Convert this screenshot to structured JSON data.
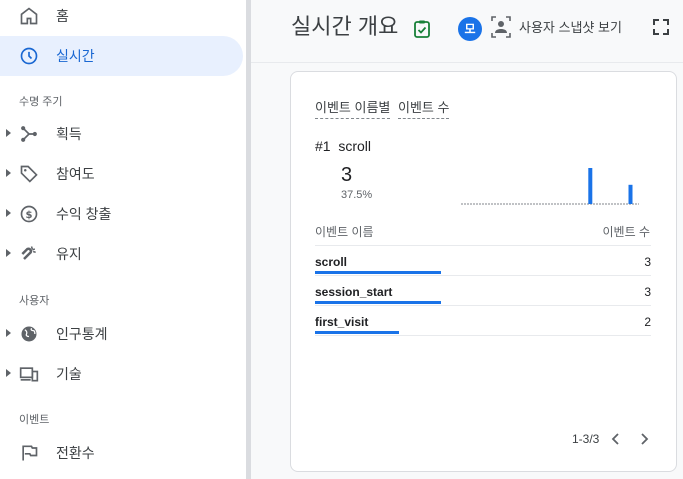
{
  "sidebar": {
    "items": [
      {
        "label": "홈",
        "icon": "home-icon"
      },
      {
        "label": "실시간",
        "icon": "clock-icon",
        "active": true
      }
    ],
    "lifecycle_label": "수명 주기",
    "lifecycle_items": [
      {
        "label": "획득",
        "icon": "acquisition-icon"
      },
      {
        "label": "참여도",
        "icon": "tag-icon"
      },
      {
        "label": "수익 창출",
        "icon": "dollar-icon"
      },
      {
        "label": "유지",
        "icon": "magnet-icon"
      }
    ],
    "user_label": "사용자",
    "user_items": [
      {
        "label": "인구통계",
        "icon": "globe-icon"
      },
      {
        "label": "기술",
        "icon": "devices-icon"
      }
    ],
    "events_label": "이벤트",
    "events_items": [
      {
        "label": "전환수",
        "icon": "flag-icon"
      }
    ]
  },
  "header": {
    "title": "실시간 개요",
    "avatar_letter": "모",
    "snapshot_label": "사용자 스냅샷 보기"
  },
  "card": {
    "title_part1": "이벤트 이름별",
    "title_part2": "이벤트 수",
    "top_rank": "#1",
    "top_name": "scroll",
    "top_value": "3",
    "top_percent": "37.5%",
    "spark_values": [
      0,
      0,
      0,
      0,
      0,
      0,
      0,
      0,
      0,
      0,
      0,
      0,
      0,
      0,
      0,
      0,
      0,
      0,
      0,
      0,
      0,
      0,
      3,
      0,
      0,
      0,
      0,
      0,
      0,
      1.6,
      0
    ],
    "col_name": "이벤트 이름",
    "col_count": "이벤트 수",
    "rows": [
      {
        "name": "scroll",
        "count": "3",
        "share": 1.0
      },
      {
        "name": "session_start",
        "count": "3",
        "share": 1.0
      },
      {
        "name": "first_visit",
        "count": "2",
        "share": 0.67
      }
    ],
    "pager": "1-3/3"
  },
  "colors": {
    "accent": "#1a73e8",
    "active_bg": "#e8f0fe",
    "check_green": "#188038"
  }
}
